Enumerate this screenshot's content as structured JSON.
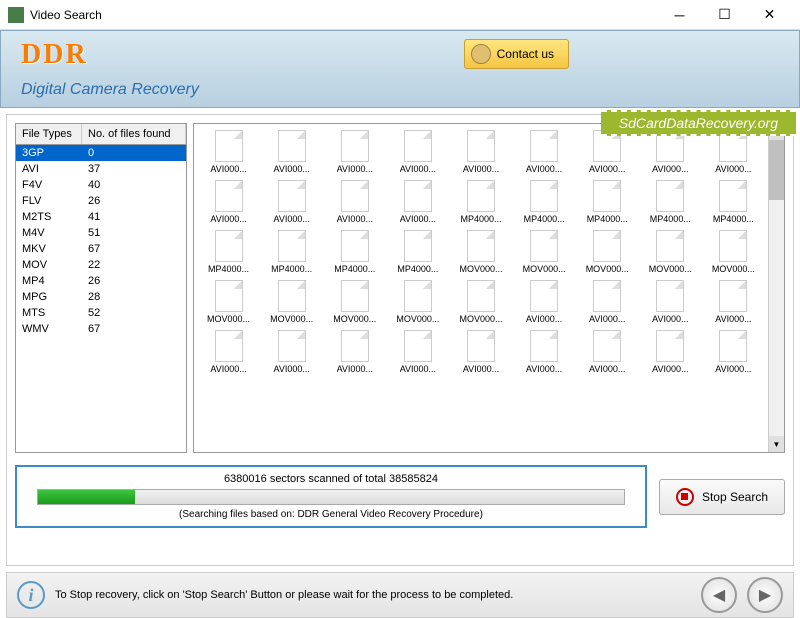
{
  "window": {
    "title": "Video Search"
  },
  "banner": {
    "brand": "DDR",
    "subtitle": "Digital Camera Recovery",
    "contact_label": "Contact us",
    "url_ribbon": "SdCardDataRecovery.org"
  },
  "file_types": {
    "col1_header": "File Types",
    "col2_header": "No. of files found",
    "rows": [
      {
        "type": "3GP",
        "count": "0",
        "selected": true
      },
      {
        "type": "AVI",
        "count": "37"
      },
      {
        "type": "F4V",
        "count": "40"
      },
      {
        "type": "FLV",
        "count": "26"
      },
      {
        "type": "M2TS",
        "count": "41"
      },
      {
        "type": "M4V",
        "count": "51"
      },
      {
        "type": "MKV",
        "count": "67"
      },
      {
        "type": "MOV",
        "count": "22"
      },
      {
        "type": "MP4",
        "count": "26"
      },
      {
        "type": "MPG",
        "count": "28"
      },
      {
        "type": "MTS",
        "count": "52"
      },
      {
        "type": "WMV",
        "count": "67"
      }
    ]
  },
  "thumbnails": [
    "AVI000...",
    "AVI000...",
    "AVI000...",
    "AVI000...",
    "AVI000...",
    "AVI000...",
    "AVI000...",
    "AVI000...",
    "AVI000...",
    "AVI000...",
    "AVI000...",
    "AVI000...",
    "AVI000...",
    "MP4000...",
    "MP4000...",
    "MP4000...",
    "MP4000...",
    "MP4000...",
    "MP4000...",
    "MP4000...",
    "MP4000...",
    "MP4000...",
    "MOV000...",
    "MOV000...",
    "MOV000...",
    "MOV000...",
    "MOV000...",
    "MOV000...",
    "MOV000...",
    "MOV000...",
    "MOV000...",
    "MOV000...",
    "AVI000...",
    "AVI000...",
    "AVI000...",
    "AVI000...",
    "AVI000...",
    "AVI000...",
    "AVI000...",
    "AVI000...",
    "AVI000...",
    "AVI000...",
    "AVI000...",
    "AVI000...",
    "AVI000..."
  ],
  "progress": {
    "text": "6380016 sectors scanned of total 38585824",
    "subtext": "(Searching files based on:  DDR General Video Recovery Procedure)",
    "stop_label": "Stop Search"
  },
  "footer": {
    "text": "To Stop recovery, click on 'Stop Search' Button or please wait for the process to be completed."
  }
}
